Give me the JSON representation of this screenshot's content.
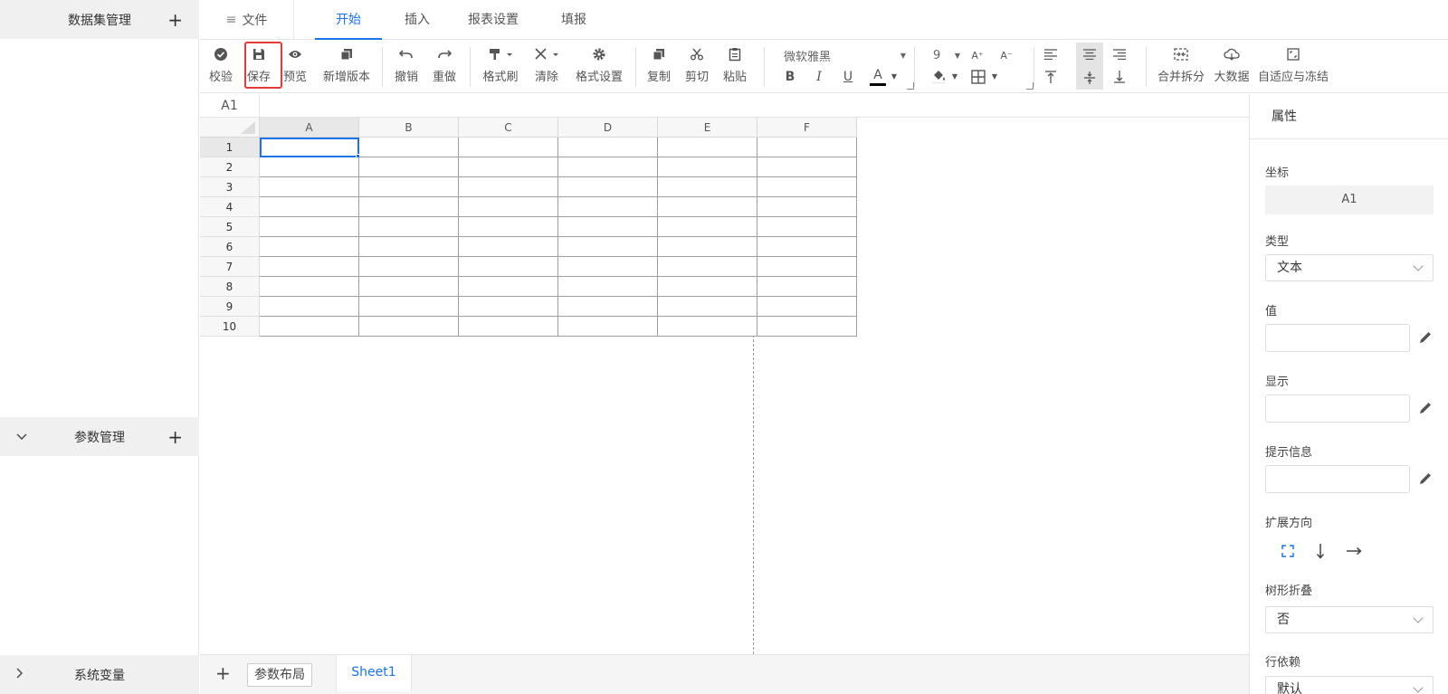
{
  "sidebar": {
    "dataset_title": "数据集管理",
    "param_title": "参数管理",
    "sysvar_title": "系统变量",
    "plus": "+"
  },
  "topbar": {
    "file_label": "文件",
    "tabs": [
      {
        "label": "开始",
        "active": true
      },
      {
        "label": "插入",
        "active": false
      },
      {
        "label": "报表设置",
        "active": false
      },
      {
        "label": "填报",
        "active": false
      }
    ]
  },
  "toolbar": {
    "buttons": {
      "check": "校验",
      "save": "保存",
      "preview": "预览",
      "new_version": "新增版本",
      "undo": "撤销",
      "redo": "重做",
      "format_painter": "格式刷",
      "clear": "清除",
      "format_settings": "格式设置",
      "copy": "复制",
      "cut": "剪切",
      "paste": "粘贴",
      "merge_split": "合并拆分",
      "big_data": "大数据",
      "fit_freeze": "自适应与冻结"
    },
    "font_family": "微软雅黑",
    "font_size": "9",
    "bold": "B",
    "italic": "I",
    "underline": "U",
    "font_color": "A",
    "font_grow": "A⁺",
    "font_shrink": "A⁻",
    "highlight_color": "#e53935",
    "accent_color": "#1a73e8"
  },
  "sheet": {
    "cell_ref": "A1",
    "columns": [
      "A",
      "B",
      "C",
      "D",
      "E",
      "F"
    ],
    "rows": [
      "1",
      "2",
      "3",
      "4",
      "5",
      "6",
      "7",
      "8",
      "9",
      "10"
    ],
    "selected_column": "A",
    "selected_row": "1"
  },
  "sheetbar": {
    "add": "+",
    "param_layout": "参数布局",
    "sheet_name": "Sheet1"
  },
  "panel": {
    "title": "属性",
    "coord_label": "坐标",
    "coord_value": "A1",
    "type_label": "类型",
    "type_value": "文本",
    "value_label": "值",
    "display_label": "显示",
    "tip_label": "提示信息",
    "expand_label": "扩展方向",
    "tree_label": "树形折叠",
    "tree_value": "否",
    "row_dep_label": "行依赖",
    "row_dep_value": "默认"
  }
}
